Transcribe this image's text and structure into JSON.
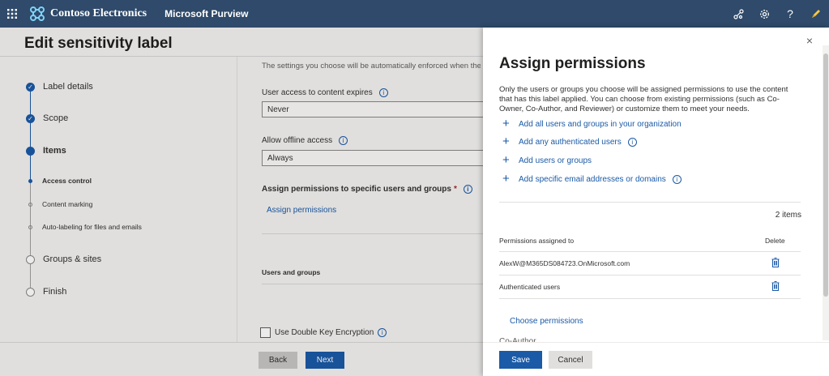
{
  "topbar": {
    "brand_name": "Contoso Electronics",
    "app_name": "Microsoft Purview",
    "icons": [
      "app-launcher-icon",
      "contoso-logo-icon",
      "share-icon",
      "gear-icon",
      "help-icon",
      "pen-icon"
    ],
    "help_label": "?"
  },
  "page": {
    "title": "Edit sensitivity label",
    "steps": [
      {
        "label": "Label details",
        "status": "done"
      },
      {
        "label": "Scope",
        "status": "done"
      },
      {
        "label": "Items",
        "status": "current"
      },
      {
        "label": "Access control",
        "status": "current-sub"
      },
      {
        "label": "Content marking",
        "status": "sub"
      },
      {
        "label": "Auto-labeling for files and emails",
        "status": "sub"
      },
      {
        "label": "Groups & sites",
        "status": "pending"
      },
      {
        "label": "Finish",
        "status": "pending"
      }
    ],
    "form": {
      "note": "The settings you choose will be automatically enforced when the la",
      "expires_label": "User access to content expires",
      "expires_value": "Never",
      "offline_label": "Allow offline access",
      "offline_value": "Always",
      "assign_label": "Assign permissions to specific users and groups",
      "required_mark": "*",
      "assign_link": "Assign permissions",
      "users_groups_header": "Users and groups",
      "double_key_label": "Use Double Key Encryption"
    },
    "footer": {
      "back": "Back",
      "next": "Next"
    }
  },
  "panel": {
    "close": "×",
    "title": "Assign permissions",
    "description": "Only the users or groups you choose will be assigned permissions to use the content that has this label applied. You can choose from existing permissions (such as Co-Owner, Co-Author, and Reviewer) or customize them to meet your needs.",
    "add_links": [
      {
        "label": "Add all users and groups in your organization",
        "info": false
      },
      {
        "label": "Add any authenticated users",
        "info": true
      },
      {
        "label": "Add users or groups",
        "info": false
      },
      {
        "label": "Add specific email addresses or domains",
        "info": true
      }
    ],
    "items_count": "2 items",
    "columns": {
      "permissions": "Permissions assigned to",
      "delete": "Delete"
    },
    "rows": [
      "AlexW@M365DS084723.OnMicrosoft.com",
      "Authenticated users"
    ],
    "choose_permissions": "Choose permissions",
    "cut_text": "Co-Author",
    "save": "Save",
    "cancel": "Cancel"
  },
  "colors": {
    "accent": "#1b5aa6",
    "topbar": "#2f4a6a"
  }
}
